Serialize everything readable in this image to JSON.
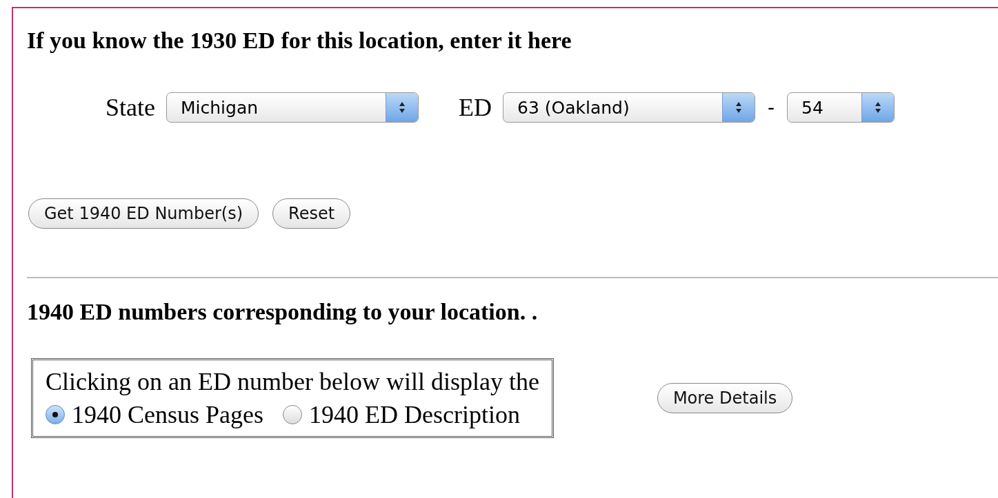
{
  "form_heading": "If you know the 1930 ED for this location, enter it here",
  "state_select": {
    "label": "State",
    "value": "Michigan"
  },
  "ed_select": {
    "label": "ED",
    "value": "63 (Oakland)"
  },
  "separator": "-",
  "sub_select": {
    "value": "54"
  },
  "buttons": [
    "Get 1940 ED Number(s)",
    "Reset"
  ],
  "results_heading": "**1940 ED numbers corresponding to your location**. .",
  "display_box": {
    "text": "Clicking on an ED number below will display the",
    "options": [
      {
        "label": "1940 Census Pages",
        "selected": true
      },
      {
        "label": "1940 ED Description",
        "selected": false
      }
    ]
  },
  "details_button": "More Details"
}
